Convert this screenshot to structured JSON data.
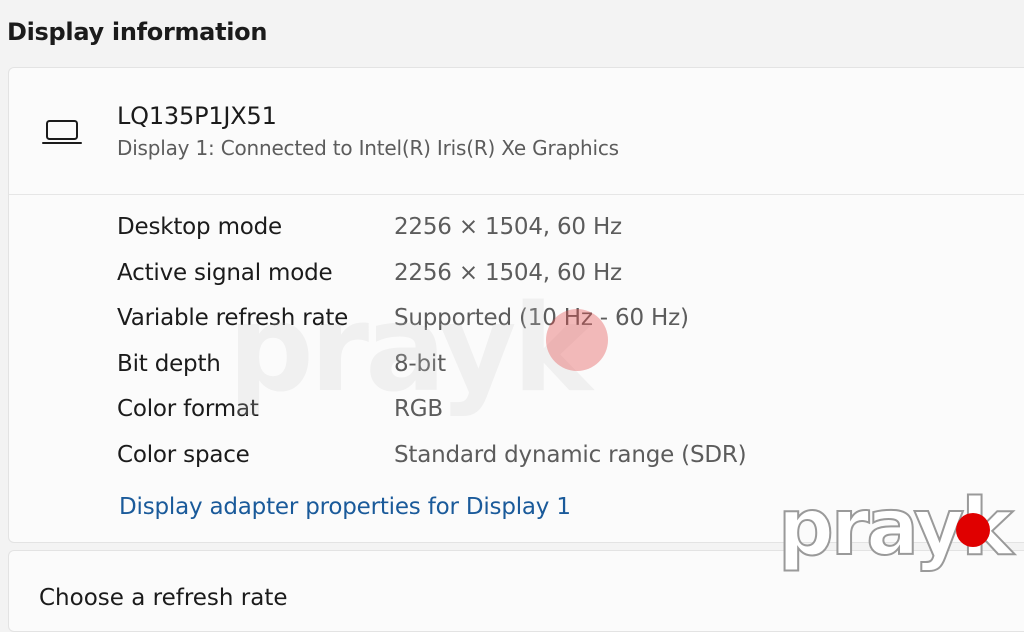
{
  "section": {
    "title": "Display information"
  },
  "display": {
    "name": "LQ135P1JX51",
    "subtitle": "Display 1: Connected to Intel(R) Iris(R) Xe Graphics",
    "icon": "laptop-icon"
  },
  "properties": [
    {
      "label": "Desktop mode",
      "value": "2256 × 1504, 60 Hz"
    },
    {
      "label": "Active signal mode",
      "value": "2256 × 1504, 60 Hz"
    },
    {
      "label": "Variable refresh rate",
      "value": "Supported (10 Hz - 60 Hz)"
    },
    {
      "label": "Bit depth",
      "value": "8-bit"
    },
    {
      "label": "Color format",
      "value": "RGB"
    },
    {
      "label": "Color space",
      "value": "Standard dynamic range (SDR)"
    }
  ],
  "link": {
    "adapter_properties": "Display adapter properties for Display 1"
  },
  "next_section": {
    "title": "Choose a refresh rate"
  },
  "watermark": {
    "text": "prayk"
  }
}
